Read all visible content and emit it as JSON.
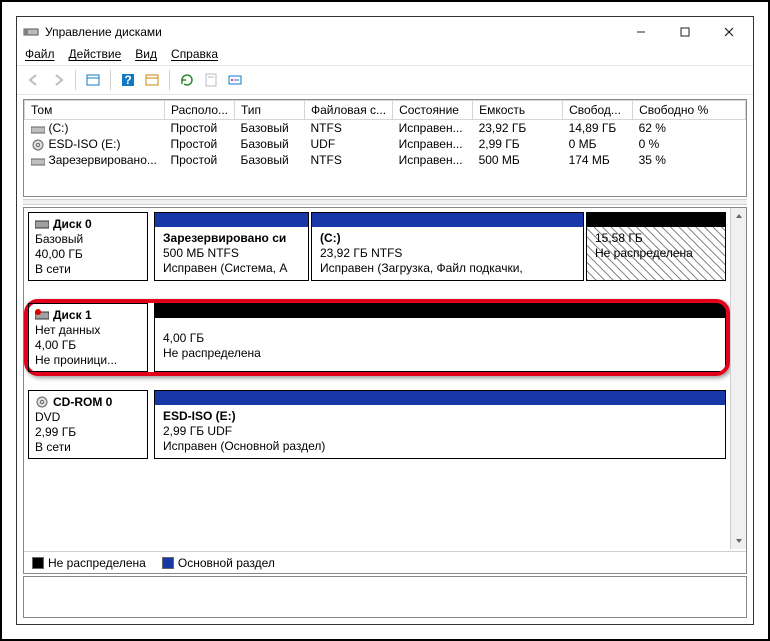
{
  "window": {
    "title": "Управление дисками"
  },
  "window_controls": {
    "minimize": "—",
    "maximize": "☐",
    "close": "✕"
  },
  "menu": {
    "file": "Файл",
    "action": "Действие",
    "view": "Вид",
    "help": "Справка"
  },
  "columns": {
    "volume": "Том",
    "layout": "Располо...",
    "type": "Тип",
    "filesystem": "Файловая с...",
    "status": "Состояние",
    "capacity": "Емкость",
    "free": "Свобод...",
    "free_pct": "Свободно %"
  },
  "volumes": [
    {
      "icon": "vol",
      "name": "(C:)",
      "layout": "Простой",
      "type": "Базовый",
      "fs": "NTFS",
      "status": "Исправен...",
      "capacity": "23,92 ГБ",
      "free": "14,89 ГБ",
      "pct": "62 %"
    },
    {
      "icon": "cd",
      "name": "ESD-ISO (E:)",
      "layout": "Простой",
      "type": "Базовый",
      "fs": "UDF",
      "status": "Исправен...",
      "capacity": "2,99 ГБ",
      "free": "0 МБ",
      "pct": "0 %"
    },
    {
      "icon": "vol",
      "name": "Зарезервировано...",
      "layout": "Простой",
      "type": "Базовый",
      "fs": "NTFS",
      "status": "Исправен...",
      "capacity": "500 МБ",
      "free": "174 МБ",
      "pct": "35 %"
    }
  ],
  "disks": {
    "d0": {
      "title": "Диск 0",
      "type": "Базовый",
      "size": "40,00 ГБ",
      "status": "В сети",
      "p1": {
        "name": "Зарезервировано си",
        "size": "500 МБ NTFS",
        "status": "Исправен (Система, А"
      },
      "p2": {
        "name": "(C:)",
        "size": "23,92 ГБ NTFS",
        "status": "Исправен (Загрузка, Файл подкачки,"
      },
      "p3": {
        "size": "15,58 ГБ",
        "status": "Не распределена"
      }
    },
    "d1": {
      "title": "Диск 1",
      "type": "Нет данных",
      "size": "4,00 ГБ",
      "status": "Не проиници...",
      "p1": {
        "size": "4,00 ГБ",
        "status": "Не распределена"
      }
    },
    "cd0": {
      "title": "CD-ROM 0",
      "type": "DVD",
      "size": "2,99 ГБ",
      "status": "В сети",
      "p1": {
        "name": "ESD-ISO  (E:)",
        "size": "2,99 ГБ UDF",
        "status": "Исправен (Основной раздел)"
      }
    }
  },
  "legend": {
    "unallocated": "Не распределена",
    "primary": "Основной раздел"
  }
}
